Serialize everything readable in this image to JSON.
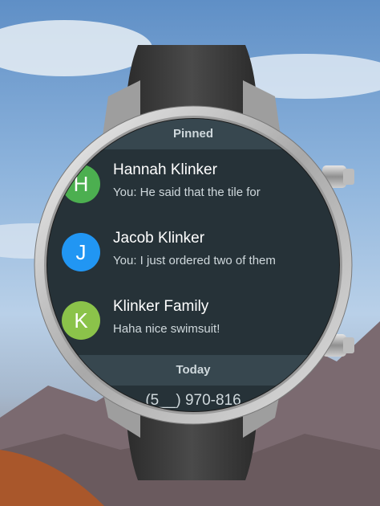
{
  "pinned_header": "Pinned",
  "today_header": "Today",
  "conversations": [
    {
      "initial": "H",
      "name": "Hannah Klinker",
      "preview": "You: He said that the tile for",
      "avatar_color": "#4caf50"
    },
    {
      "initial": "J",
      "name": "Jacob Klinker",
      "preview": "You: I just ordered two of them",
      "avatar_color": "#2196f3"
    },
    {
      "initial": "K",
      "name": "Klinker Family",
      "preview": "Haha nice swimsuit!",
      "avatar_color": "#8bc34a"
    }
  ],
  "partial_item_text": "(5__) 970-816"
}
